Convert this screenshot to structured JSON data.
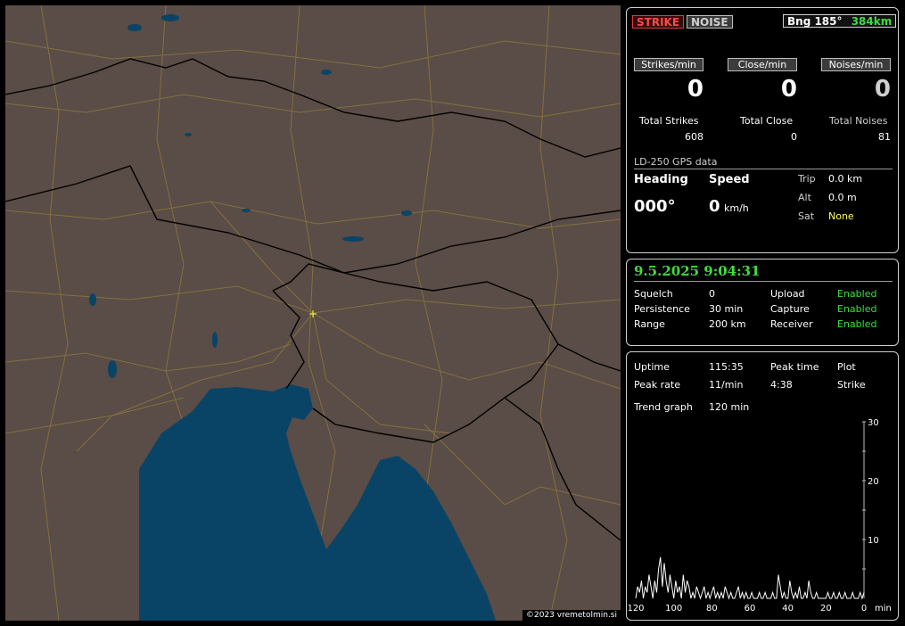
{
  "map": {
    "copyright": "©2023 vremetolmin.si",
    "colors": {
      "land": "#5a4c46",
      "sea": "#094466",
      "border": "#000000",
      "roads": "#8e7a3c",
      "marker": "#ffff44"
    }
  },
  "status": {
    "strike_label": "STRIKE",
    "noise_label": "NOISE",
    "bearing_label": "Bng 185°",
    "range_label": "384km"
  },
  "rates": {
    "strikes_btn": "Strikes/min",
    "close_btn": "Close/min",
    "noises_btn": "Noises/min",
    "strikes_val": "0",
    "close_val": "0",
    "noises_val": "0"
  },
  "totals": {
    "strikes_label": "Total Strikes",
    "close_label": "Total Close",
    "noises_label": "Total Noises",
    "strikes_val": "608",
    "close_val": "0",
    "noises_val": "81"
  },
  "gps": {
    "title": "LD-250 GPS data",
    "heading_label": "Heading",
    "speed_label": "Speed",
    "heading_val": "000°",
    "speed_val": "0",
    "speed_unit": "km/h",
    "trip_label": "Trip",
    "trip_val": "0.0 km",
    "alt_label": "Alt",
    "alt_val": "0.0 m",
    "sat_label": "Sat",
    "sat_val": "None"
  },
  "settings": {
    "datetime": "9.5.2025 9:04:31",
    "squelch_label": "Squelch",
    "squelch_val": "0",
    "persistence_label": "Persistence",
    "persistence_val": "30 min",
    "range_label": "Range",
    "range_val": "200 km",
    "upload_label": "Upload",
    "upload_val": "Enabled",
    "capture_label": "Capture",
    "capture_val": "Enabled",
    "receiver_label": "Receiver",
    "receiver_val": "Enabled"
  },
  "stats": {
    "uptime_label": "Uptime",
    "uptime_val": "115:35",
    "peak_time_label": "Peak time",
    "plot_label": "Plot",
    "peak_rate_label": "Peak rate",
    "peak_rate_val": "11/min",
    "peak_time_val": "4:38",
    "plot_val": "Strike",
    "trend_label": "Trend graph",
    "trend_val": "120 min"
  },
  "chart_data": {
    "type": "line",
    "title": "",
    "xlabel": "min",
    "ylabel": "",
    "x_reversed": true,
    "xlim": [
      120,
      0
    ],
    "ylim": [
      0,
      30
    ],
    "x_ticks": [
      "120",
      "100",
      "80",
      "60",
      "40",
      "20",
      "0"
    ],
    "y_ticks": [
      "10",
      "20",
      "30"
    ],
    "series": [
      {
        "x": [
          120,
          119,
          118,
          117,
          116,
          115,
          114,
          113,
          112,
          111,
          110,
          109,
          108,
          107,
          106,
          105,
          104,
          103,
          102,
          101,
          100,
          99,
          98,
          97,
          96,
          95,
          94,
          93,
          92,
          91,
          90,
          89,
          88,
          87,
          86,
          85,
          84,
          83,
          82,
          81,
          80,
          79,
          78,
          77,
          76,
          75,
          74,
          73,
          72,
          71,
          70,
          69,
          68,
          67,
          66,
          65,
          64,
          63,
          62,
          61,
          60,
          59,
          58,
          57,
          56,
          55,
          54,
          53,
          52,
          51,
          50,
          49,
          48,
          47,
          46,
          45,
          44,
          43,
          42,
          41,
          40,
          39,
          38,
          37,
          36,
          35,
          34,
          33,
          32,
          31,
          30,
          29,
          28,
          27,
          26,
          25,
          24,
          23,
          22,
          21,
          20,
          19,
          18,
          17,
          16,
          15,
          14,
          13,
          12,
          11,
          10,
          9,
          8,
          7,
          6,
          5,
          4,
          3,
          2,
          1,
          0
        ],
        "values": [
          0,
          2,
          1,
          3,
          0,
          2,
          1,
          4,
          2,
          0,
          3,
          1,
          5,
          7,
          2,
          6,
          3,
          1,
          4,
          2,
          0,
          3,
          1,
          2,
          0,
          4,
          1,
          3,
          2,
          0,
          1,
          0,
          2,
          1,
          0,
          1,
          2,
          0,
          1,
          0,
          1,
          2,
          0,
          1,
          0,
          1,
          0,
          2,
          1,
          0,
          1,
          0,
          0,
          1,
          2,
          0,
          1,
          0,
          1,
          0,
          0,
          1,
          0,
          0,
          0,
          1,
          0,
          0,
          1,
          0,
          0,
          0,
          1,
          0,
          0,
          4,
          2,
          0,
          1,
          0,
          0,
          3,
          1,
          0,
          1,
          0,
          2,
          0,
          0,
          1,
          0,
          3,
          1,
          0,
          0,
          1,
          0,
          0,
          0,
          0,
          0,
          1,
          0,
          0,
          1,
          0,
          0,
          1,
          0,
          0,
          1,
          0,
          0,
          0,
          1,
          0,
          0,
          0,
          1,
          0,
          1
        ]
      }
    ]
  }
}
